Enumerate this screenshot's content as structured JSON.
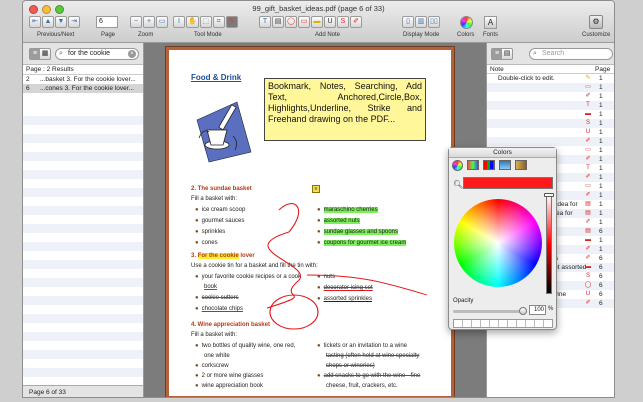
{
  "window": {
    "title": "99_gift_basket_ideas.pdf (page 6 of 33)"
  },
  "toolbar": {
    "prev_next_label": "Previous/Next",
    "page_label": "Page",
    "page_value": "6",
    "zoom_label": "Zoom",
    "tool_mode_label": "Tool Mode",
    "add_note_label": "Add Note",
    "display_mode_label": "Display Mode",
    "colors_label": "Colors",
    "fonts_label": "Fonts",
    "customize_label": "Customize"
  },
  "left_panel": {
    "search_value": "for the cookie",
    "results_header": "Page : 2 Results",
    "results": [
      {
        "page": "2",
        "text": "...basket 3. For the cookie lover..."
      },
      {
        "page": "6",
        "text": "...cones 3. For the cookie lover..."
      }
    ],
    "status": "Page 6 of 33"
  },
  "right_panel": {
    "search_placeholder": "Search",
    "col_note": "Note",
    "col_page": "Page",
    "first_note": "Double-click to edit.",
    "notes": [
      {
        "text": "",
        "page": "1"
      },
      {
        "text": "",
        "page": "1"
      },
      {
        "text": "",
        "page": "1"
      },
      {
        "text": "",
        "page": "1"
      },
      {
        "text": "",
        "page": "1"
      },
      {
        "text": "",
        "page": "1"
      },
      {
        "text": "",
        "page": "1"
      },
      {
        "text": "",
        "page": "1"
      },
      {
        "text": "",
        "page": "1"
      },
      {
        "text": "",
        "page": "1"
      },
      {
        "text": "",
        "page": "1"
      },
      {
        "text": "",
        "page": "1"
      },
      {
        "text": "",
        "page": "1"
      },
      {
        "text": "",
        "page": "1"
      },
      {
        "text": "s a gift idea for",
        "page": "1"
      },
      {
        "text": "a gift idea for",
        "page": "1"
      },
      {
        "text": "",
        "page": "1"
      },
      {
        "text": "otes.",
        "page": "6"
      },
      {
        "text": "",
        "page": "1"
      },
      {
        "text": "",
        "page": "1"
      },
      {
        "text": "cherries",
        "page": "6"
      },
      {
        "text": "g basket assorted",
        "page": "6"
      },
      {
        "text": "cutters",
        "page": "6"
      },
      {
        "text": "",
        "page": "6"
      },
      {
        "text": "eld at wine",
        "page": "6"
      },
      {
        "text": "",
        "page": "6"
      }
    ]
  },
  "pdf": {
    "section": "Food & Drink",
    "note_text": "Bookmark, Notes, Searching, Add Text, Anchored,Circle,Box, Highlights,Underline, Strike and Freehand drawing on the PDF...",
    "h2": "2.  The sundae basket",
    "fill1": "Fill a basket with:",
    "list2a": [
      "ice cream scoop",
      "gourmet sauces",
      "sprinkles",
      "cones"
    ],
    "list2b": [
      "maraschino cherries",
      "assorted nuts",
      "sundae glasses and spoons",
      "coupons for gourmet ice cream"
    ],
    "h3_num": "3.",
    "h3": "For the cookie",
    "h3_rest": "lover",
    "fill3": "Use a cookie tin for a basket and fill the tin with:",
    "list3a": [
      "your favorite cookie recipes or a cook",
      "book",
      "cookie cutters",
      "chocolate chips"
    ],
    "list3b": [
      "nuts",
      "decorator icing set",
      "assorted sprinkles"
    ],
    "h4": "4.  Wine appreciation basket",
    "fill4": "Fill a basket with:",
    "list4a": [
      "two bottles of quality wine, one red,",
      "one white",
      "corkscrew",
      "2 or more wine glasses",
      "wine appreciation book"
    ],
    "list4b": [
      "tickets or an invitation to a wine",
      "tasting (often held at wine specialty",
      "shops or wineries)",
      "add snacks to go with the wine - fine",
      "cheese, fruit, crackers, etc."
    ]
  },
  "colors_panel": {
    "title": "Colors",
    "opacity_label": "Opacity",
    "opacity_value": "100",
    "percent": "%",
    "selected_color": "#ff1a1a"
  },
  "accent": {
    "highlight": "#7cf05a",
    "note_bg": "#fff79a",
    "ink": "#e0191c",
    "border": "#b2613a"
  }
}
